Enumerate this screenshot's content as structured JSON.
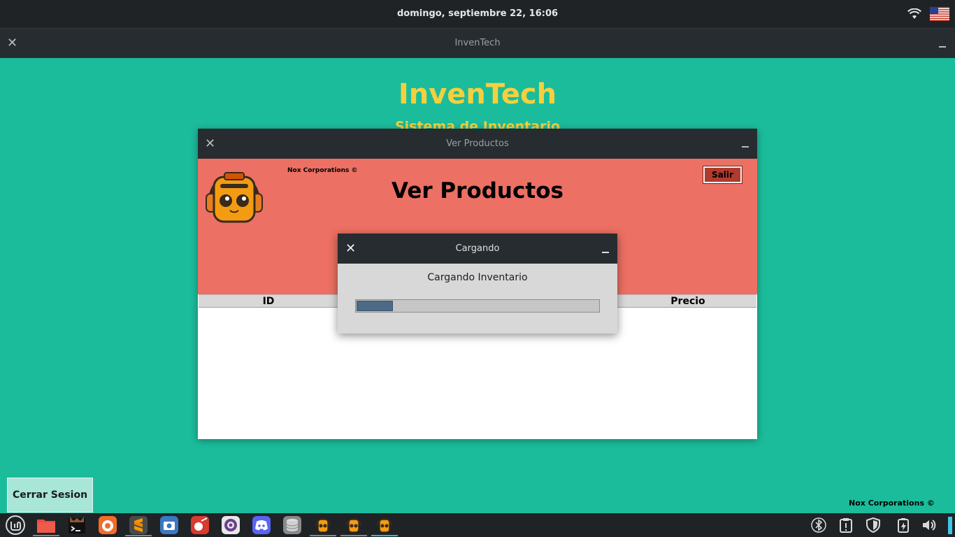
{
  "topbar": {
    "clock": "domingo, septiembre 22, 16:06",
    "wifi_icon": "wifi-icon",
    "flag_icon": "us-flag-icon"
  },
  "main_window": {
    "title": "InvenTech",
    "app_title": "InvenTech",
    "app_subtitle": "Sistema de Inventario"
  },
  "ver_productos": {
    "window_title": "Ver Productos",
    "brand": "Nox Corporations ©",
    "heading": "Ver Productos",
    "exit_label": "Salir",
    "columns": [
      "ID",
      "Precio"
    ]
  },
  "dialog": {
    "title": "Cargando",
    "message": "Cargando Inventario",
    "progress": 0.15
  },
  "footer": {
    "logout_label": "Cerrar Sesion",
    "brand": "Nox Corporations ©"
  },
  "taskbar": {
    "apps": [
      "mint-menu-icon",
      "files-icon",
      "terminal-icon",
      "firefox-icon",
      "sublime-text-icon",
      "screenshot-icon",
      "gimp-icon",
      "obs-icon",
      "discord-icon",
      "database-icon",
      "inventech-window-icon",
      "inventech-window-icon",
      "inventech-window-icon"
    ],
    "tray": [
      "bluetooth-icon",
      "clipboard-icon",
      "shield-icon",
      "battery-icon",
      "volume-icon"
    ]
  },
  "colors": {
    "background": "#1bbc9b",
    "accent_title": "#f4d03f",
    "header": "#ec7063",
    "titlebar": "#262c2f",
    "progress": "#4c6a85"
  }
}
